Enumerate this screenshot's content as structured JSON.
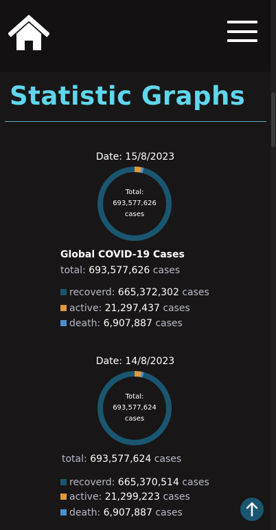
{
  "colors": {
    "accent": "#5fd6ec",
    "recovered": "#1a5670",
    "active": "#e09a3b",
    "death": "#4d8fcc"
  },
  "page_title": "Statistic Graphs",
  "heading": "Global COVID-19 Cases",
  "reports": [
    {
      "date_label": "Date: 15/8/2023",
      "donut": {
        "line1": "Total:",
        "line2": "693,577,626",
        "line3": "cases"
      },
      "total_label": "total:",
      "total_value": "693,577,626",
      "unit": "cases",
      "recovered_label": "recoverd:",
      "recovered_value": "665,372,302",
      "recovered_count": 665372302,
      "active_label": "active:",
      "active_value": "21,297,437",
      "active_count": 21297437,
      "death_label": "death:",
      "death_value": "6,907,887",
      "death_count": 6907887
    },
    {
      "date_label": "Date: 14/8/2023",
      "donut": {
        "line1": "Total:",
        "line2": "693,577,624",
        "line3": "cases"
      },
      "total_label": "total:",
      "total_value": "693,577,624",
      "unit": "cases",
      "recovered_label": "recoverd:",
      "recovered_value": "665,370,514",
      "recovered_count": 665370514,
      "active_label": "active:",
      "active_value": "21,299,223",
      "active_count": 21299223,
      "death_label": "death:",
      "death_value": "6,907,887",
      "death_count": 6907887
    }
  ]
}
